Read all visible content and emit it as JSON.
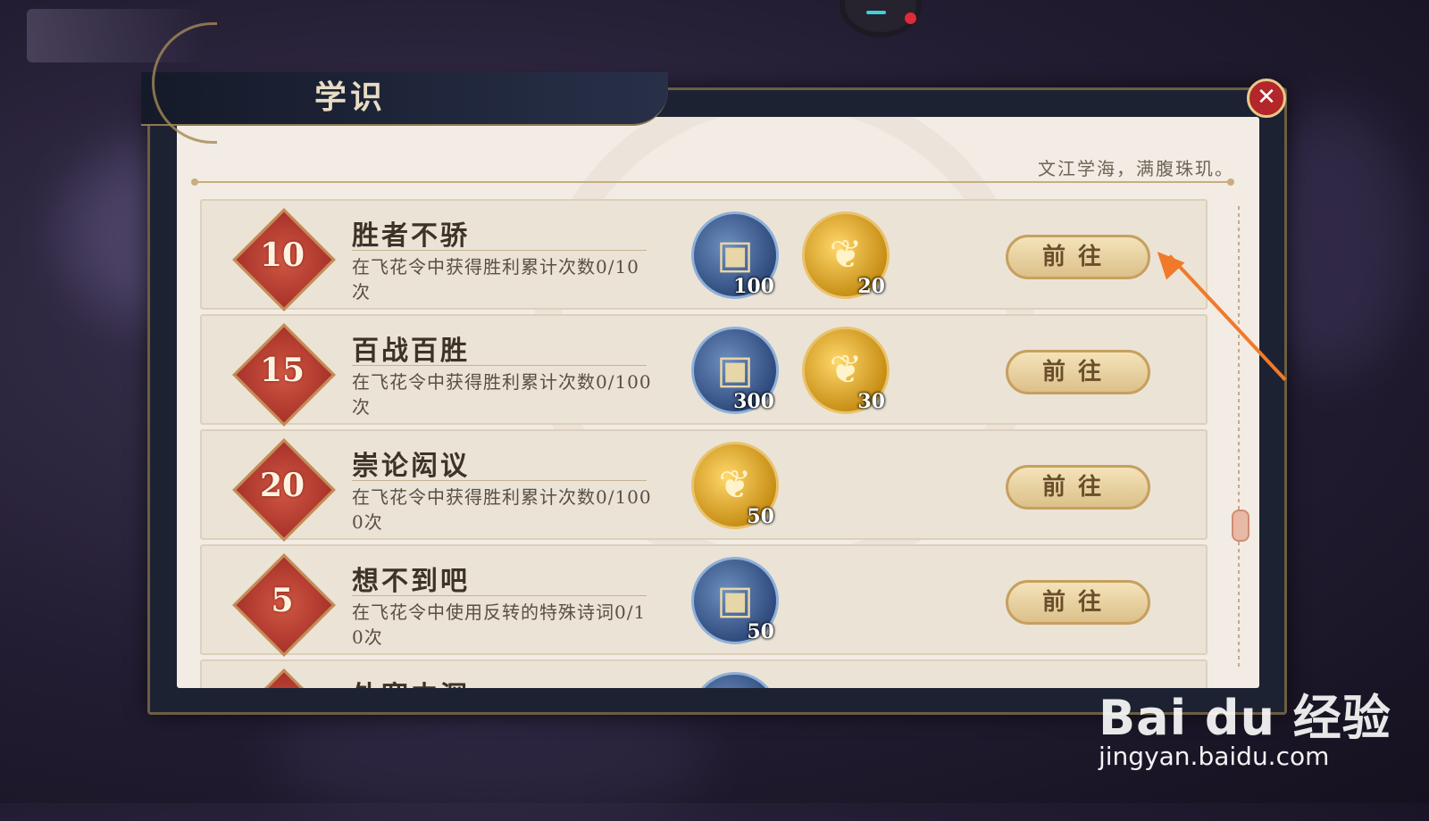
{
  "window": {
    "title": "学识",
    "subtitle": "文江学海，满腹珠玑。",
    "close_label": "✕"
  },
  "tasks": [
    {
      "badge": "10",
      "title": "胜者不骄",
      "desc": "在飞花令中获得胜利累计次数0/10次",
      "button": "前往",
      "rewards": [
        {
          "type": "bag",
          "icon": "scroll-bag-icon",
          "count": "100"
        },
        {
          "type": "feather",
          "icon": "golden-feather-icon",
          "count": "20"
        }
      ]
    },
    {
      "badge": "15",
      "title": "百战百胜",
      "desc": "在飞花令中获得胜利累计次数0/100次",
      "button": "前往",
      "rewards": [
        {
          "type": "bag",
          "icon": "scroll-bag-icon",
          "count": "300"
        },
        {
          "type": "feather",
          "icon": "golden-feather-icon",
          "count": "30"
        }
      ]
    },
    {
      "badge": "20",
      "title": "崇论闳议",
      "desc": "在飞花令中获得胜利累计次数0/1000次",
      "button": "前往",
      "rewards": [
        {
          "type": "feather",
          "icon": "golden-feather-icon",
          "count": "50"
        }
      ]
    },
    {
      "badge": "5",
      "title": "想不到吧",
      "desc": "在飞花令中使用反转的特殊诗词0/10次",
      "button": "前往",
      "rewards": [
        {
          "type": "bag",
          "icon": "scroll-bag-icon",
          "count": "50"
        }
      ]
    },
    {
      "badge": "",
      "title": "外寒内深",
      "desc": "",
      "button": "",
      "rewards": [
        {
          "type": "bag",
          "icon": "scroll-bag-icon",
          "count": ""
        }
      ]
    }
  ],
  "watermark": {
    "logo": "Bai du 经验",
    "url": "jingyan.baidu.com"
  },
  "colors": {
    "accent_red": "#a8322a",
    "gold": "#c79f5e",
    "panel": "#f2ece4",
    "annotation_arrow": "#f07a2a"
  }
}
